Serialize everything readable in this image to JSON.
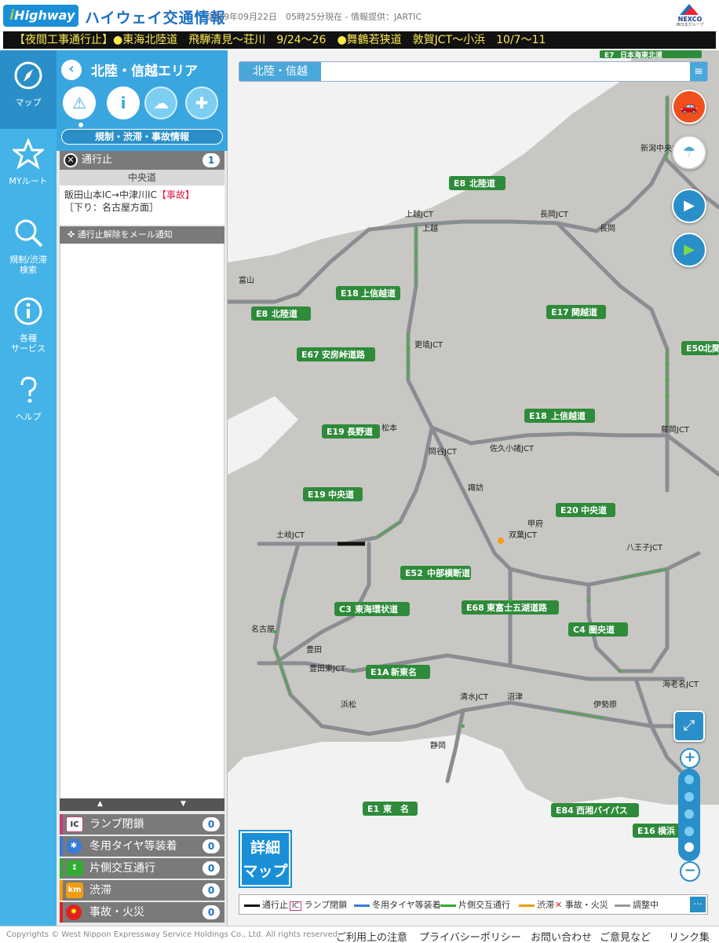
{
  "header": {
    "logo_text": "Highway",
    "app_title": "ハイウェイ交通情報",
    "date_text": "2019年09月22日　05時25分現在 - 情報提供：JARTIC",
    "nexco_name": "NEXCO",
    "nexco_sub": "西日本グループ"
  },
  "ticker": "【夜間工事通行止】●東海北陸道　飛騨清見〜荘川　9/24〜26　●舞鶴若狭道　敦賀JCT〜小浜　10/7〜11",
  "nav": [
    {
      "label": "マップ",
      "icon": "compass-icon"
    },
    {
      "label": "MYルート",
      "icon": "star-icon"
    },
    {
      "label": "規制/渋滞\n検索",
      "icon": "search-icon"
    },
    {
      "label": "各種\nサービス",
      "icon": "info-icon"
    },
    {
      "label": "ヘルプ",
      "icon": "help-icon"
    }
  ],
  "panel": {
    "area_title": "北陸・信越エリア",
    "category_label": "規制・渋滞・事故情報",
    "closure_title": "通行止",
    "closure_count": "1",
    "road_name": "中央道",
    "incident_line1": "飯田山本IC→中津川IC",
    "incident_tag": "【事故】",
    "incident_line2": "［下り：名古屋方面］",
    "notify_label": "通行止解除をメール通知",
    "categories": [
      {
        "label": "ランプ閉鎖",
        "count": "0",
        "icon_text": "IC"
      },
      {
        "label": "冬用タイヤ等装着",
        "count": "0",
        "icon_text": "✱"
      },
      {
        "label": "片側交互通行",
        "count": "0",
        "icon_text": "↕"
      },
      {
        "label": "渋滞",
        "count": "0",
        "icon_text": "km"
      },
      {
        "label": "事故・火災",
        "count": "0",
        "icon_text": "✸"
      }
    ]
  },
  "map": {
    "area_tab": "北陸・信越",
    "detail_button": "詳細\nマップ",
    "route_labels": [
      {
        "code": "E8",
        "name": "北陸道"
      },
      {
        "code": "E8",
        "name": "北陸道"
      },
      {
        "code": "E18",
        "name": "上信越道"
      },
      {
        "code": "E18",
        "name": "上信越道"
      },
      {
        "code": "E17",
        "name": "関越道"
      },
      {
        "code": "E67",
        "name": "安房峠道路"
      },
      {
        "code": "E19",
        "name": "長野道"
      },
      {
        "code": "E19",
        "name": "中央道"
      },
      {
        "code": "E20",
        "name": "中央道"
      },
      {
        "code": "E52",
        "name": "中部横断道"
      },
      {
        "code": "C3",
        "name": "東海環状道"
      },
      {
        "code": "E68",
        "name": "東富士五湖道路"
      },
      {
        "code": "C4",
        "name": "圏央道"
      },
      {
        "code": "E1A",
        "name": "新東名"
      },
      {
        "code": "E1",
        "name": "東　名"
      },
      {
        "code": "E84",
        "name": "西湘バイパス"
      },
      {
        "code": "E16",
        "name": "横浜"
      },
      {
        "code": "E50",
        "name": "北関"
      },
      {
        "code": "E7",
        "name": "日本海東北道"
      }
    ],
    "place_labels": [
      "上越JCT",
      "長岡JCT",
      "更埴JCT",
      "岡谷JCT",
      "佐久小諸JCT",
      "藤岡JCT",
      "双葉JCT",
      "八王子JCT",
      "土岐JCT",
      "清水JCT",
      "豊田東JCT",
      "海老名JCT",
      "富山",
      "上越",
      "長岡",
      "松本",
      "諏訪",
      "甲府",
      "沼津",
      "浜松",
      "豊田",
      "新潟中央JCT",
      "名古屋",
      "静岡",
      "伊勢原"
    ]
  },
  "legend": [
    {
      "label": "通行止",
      "color": "#111111"
    },
    {
      "label": "ランプ閉鎖",
      "color": "IC"
    },
    {
      "label": "冬用タイヤ等装着",
      "color": "#3a7bd5"
    },
    {
      "label": "片側交互通行",
      "color": "#33aa33"
    },
    {
      "label": "渋滞",
      "color": "#f39c12"
    },
    {
      "label": "事故・火災",
      "color": "#e02020"
    },
    {
      "label": "調整中",
      "color": "#999999"
    }
  ],
  "footer": {
    "copyright": "Copyrights © West Nippon Expressway Service Holdings Co., Ltd. All rights reserved.",
    "links": [
      "ご利用上の注意",
      "プライバシーポリシー",
      "お問い合わせ",
      "ご意見など",
      "リンク集"
    ]
  }
}
